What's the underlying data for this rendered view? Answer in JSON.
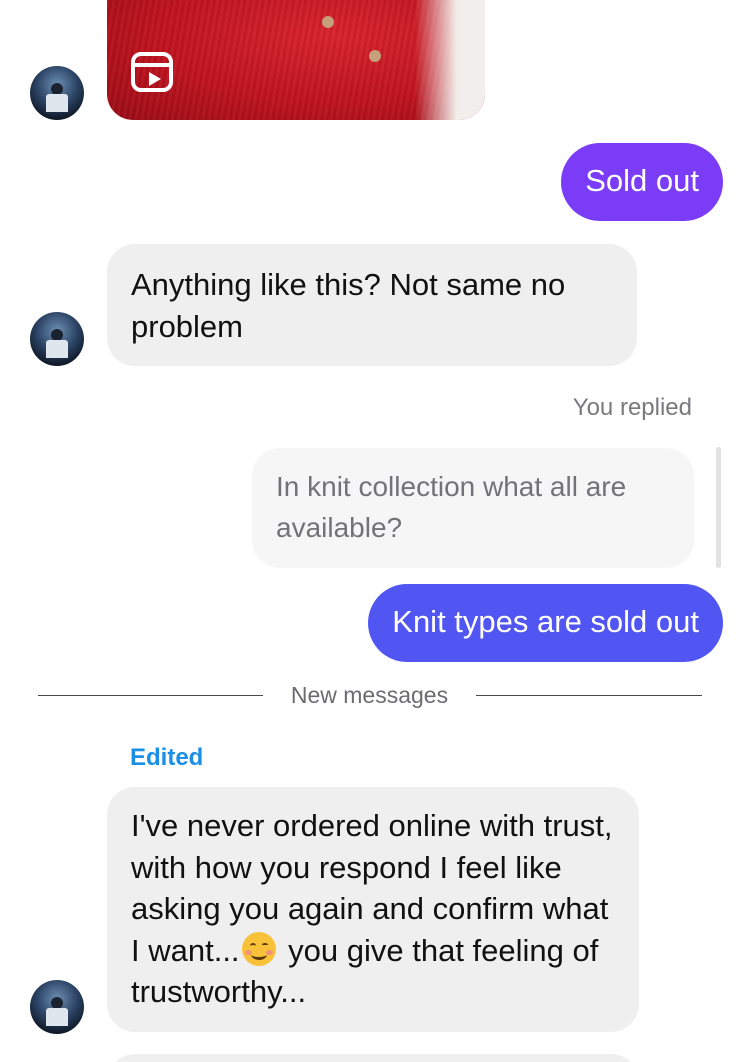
{
  "conversation": {
    "reel_attachment": {
      "icon": "reels-icon"
    },
    "messages": {
      "sold_out": "Sold out",
      "anything_like_this": "Anything like this? Not same no problem",
      "reply_label": "You replied",
      "quoted_text": "In knit collection what all are available?",
      "knit_types": "Knit types are sold out",
      "new_messages_label": "New messages",
      "edited_label": "Edited",
      "long_message_part1": "I've never ordered online with trust, with how you respond I feel like asking you again and confirm what I want...",
      "long_message_emoji": "smiling-face-emoji",
      "long_message_part2": " you give that feeling of trustworthy..."
    }
  },
  "colors": {
    "sent_purple": "#7a3cf6",
    "sent_blue": "#5156f2",
    "received_bg": "#efeff0",
    "edited_blue": "#1b8ee6"
  }
}
